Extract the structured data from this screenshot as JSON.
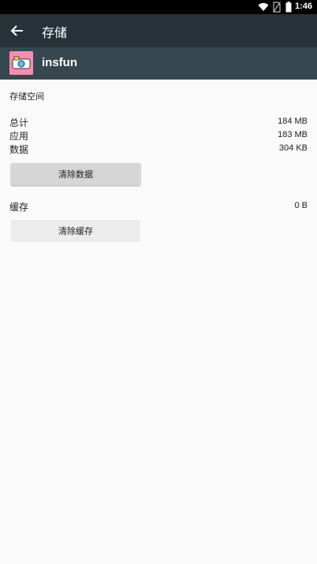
{
  "status_bar": {
    "time": "1:46",
    "icons": [
      "wifi-icon",
      "no-sim-icon",
      "battery-icon"
    ]
  },
  "appbar": {
    "title": "存储",
    "back_icon": "back-arrow-icon"
  },
  "app": {
    "name": "insfun"
  },
  "storage": {
    "section_label": "存储空间",
    "rows": [
      {
        "label": "总计",
        "value": "184 MB"
      },
      {
        "label": "应用",
        "value": "183 MB"
      },
      {
        "label": "数据",
        "value": "304 KB"
      }
    ],
    "clear_data_label": "清除数据"
  },
  "cache": {
    "label": "缓存",
    "value": "0 B",
    "clear_cache_label": "清除缓存"
  },
  "colors": {
    "status_bar": "#000000",
    "appbar": "#263238",
    "app_header": "#37474f",
    "background": "#fafafa"
  }
}
